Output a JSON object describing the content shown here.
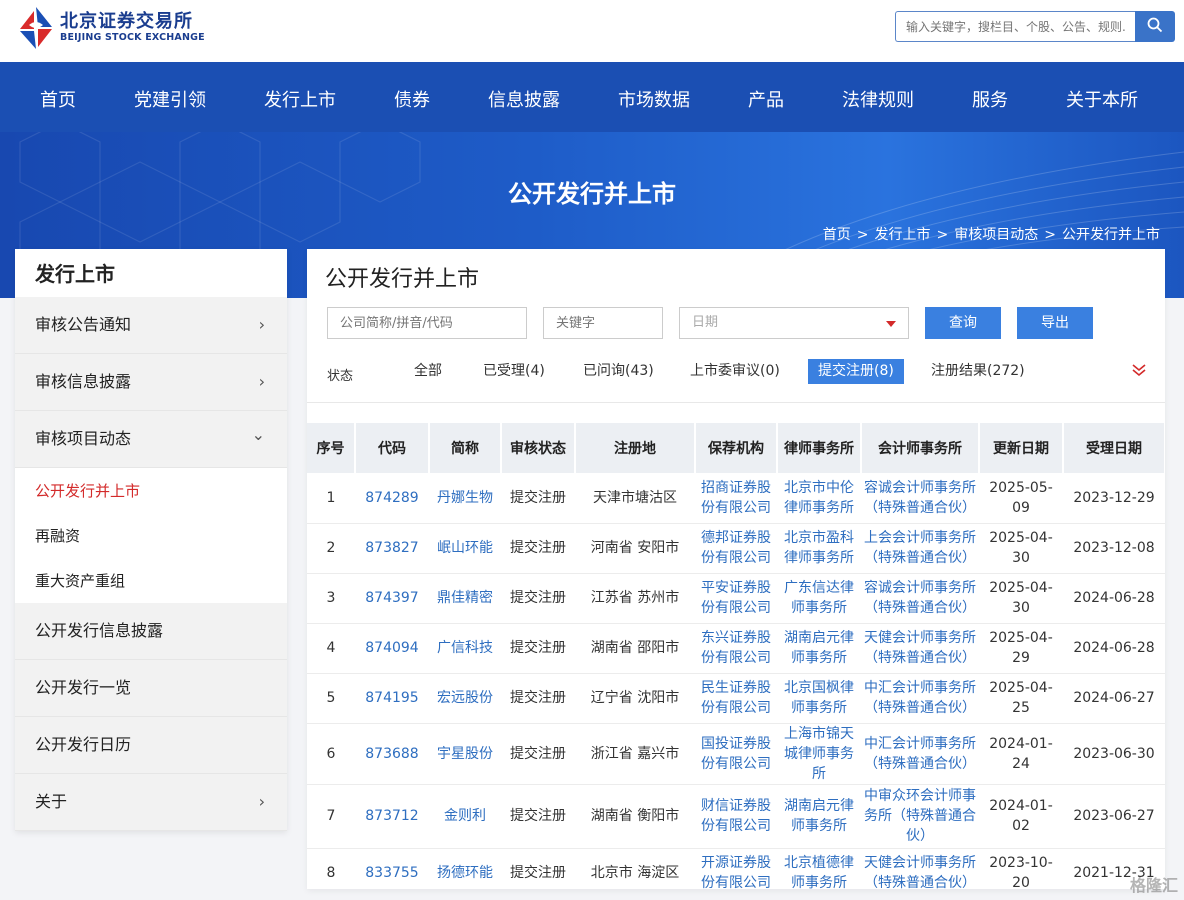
{
  "header": {
    "logo_cn": "北京证券交易所",
    "logo_en": "BEIJING STOCK EXCHANGE",
    "search_placeholder": "输入关键字，搜栏目、个股、公告、规则...",
    "search_icon": "search-icon"
  },
  "nav": [
    "首页",
    "党建引领",
    "发行上市",
    "债券",
    "信息披露",
    "市场数据",
    "产品",
    "法律规则",
    "服务",
    "关于本所"
  ],
  "banner": {
    "title": "公开发行并上市",
    "breadcrumb": [
      "首页",
      "发行上市",
      "审核项目动态",
      "公开发行并上市"
    ],
    "separator": ">"
  },
  "sidebar": {
    "title": "发行上市",
    "items": [
      {
        "label": "审核公告通知",
        "chevron": "›"
      },
      {
        "label": "审核信息披露",
        "chevron": "›"
      },
      {
        "label": "审核项目动态",
        "chevron": "⌄"
      }
    ],
    "subitems": [
      "公开发行并上市",
      "再融资",
      "重大资产重组"
    ],
    "items2": [
      {
        "label": "公开发行信息披露",
        "chevron": ""
      },
      {
        "label": "公开发行一览",
        "chevron": ""
      },
      {
        "label": "公开发行日历",
        "chevron": ""
      },
      {
        "label": "关于",
        "chevron": "›"
      }
    ]
  },
  "main": {
    "title": "公开发行并上市",
    "filters": {
      "company_placeholder": "公司简称/拼音/代码",
      "keyword_placeholder": "关键字",
      "date_placeholder": "日期",
      "query_label": "查询",
      "export_label": "导出"
    },
    "status_label": "状态",
    "status_tabs": [
      "全部",
      "已受理(4)",
      "已问询(43)",
      "上市委审议(0)",
      "提交注册(8)",
      "注册结果(272)"
    ],
    "active_status": "提交注册(8)",
    "accent_color": "#3a80e0",
    "active_color": "#d32a2a"
  },
  "table": {
    "columns": [
      "序号",
      "代码",
      "简称",
      "审核状态",
      "注册地",
      "保荐机构",
      "律师事务所",
      "会计师事务所",
      "更新日期",
      "受理日期"
    ],
    "rows": [
      {
        "no": "1",
        "code": "874289",
        "name": "丹娜生物",
        "status": "提交注册",
        "place": "天津市塘沽区",
        "sponsor": "招商证券股份有限公司",
        "law": "北京市中伦律师事务所",
        "cpa": "容诚会计师事务所（特殊普通合伙）",
        "updated": "2025-05-09",
        "accepted": "2023-12-29"
      },
      {
        "no": "2",
        "code": "873827",
        "name": "岷山环能",
        "status": "提交注册",
        "place": "河南省 安阳市",
        "sponsor": "德邦证券股份有限公司",
        "law": "北京市盈科律师事务所",
        "cpa": "上会会计师事务所（特殊普通合伙）",
        "updated": "2025-04-30",
        "accepted": "2023-12-08"
      },
      {
        "no": "3",
        "code": "874397",
        "name": "鼎佳精密",
        "status": "提交注册",
        "place": "江苏省 苏州市",
        "sponsor": "平安证券股份有限公司",
        "law": "广东信达律师事务所",
        "cpa": "容诚会计师事务所（特殊普通合伙）",
        "updated": "2025-04-30",
        "accepted": "2024-06-28"
      },
      {
        "no": "4",
        "code": "874094",
        "name": "广信科技",
        "status": "提交注册",
        "place": "湖南省 邵阳市",
        "sponsor": "东兴证券股份有限公司",
        "law": "湖南启元律师事务所",
        "cpa": "天健会计师事务所（特殊普通合伙）",
        "updated": "2025-04-29",
        "accepted": "2024-06-28"
      },
      {
        "no": "5",
        "code": "874195",
        "name": "宏远股份",
        "status": "提交注册",
        "place": "辽宁省 沈阳市",
        "sponsor": "民生证券股份有限公司",
        "law": "北京国枫律师事务所",
        "cpa": "中汇会计师事务所（特殊普通合伙）",
        "updated": "2025-04-25",
        "accepted": "2024-06-27"
      },
      {
        "no": "6",
        "code": "873688",
        "name": "宇星股份",
        "status": "提交注册",
        "place": "浙江省 嘉兴市",
        "sponsor": "国投证券股份有限公司",
        "law": "上海市锦天城律师事务所",
        "cpa": "中汇会计师事务所（特殊普通合伙）",
        "updated": "2024-01-24",
        "accepted": "2023-06-30"
      },
      {
        "no": "7",
        "code": "873712",
        "name": "金则利",
        "status": "提交注册",
        "place": "湖南省 衡阳市",
        "sponsor": "财信证券股份有限公司",
        "law": "湖南启元律师事务所",
        "cpa": "中审众环会计师事务所（特殊普通合伙）",
        "updated": "2024-01-02",
        "accepted": "2023-06-27"
      },
      {
        "no": "8",
        "code": "833755",
        "name": "扬德环能",
        "status": "提交注册",
        "place": "北京市 海淀区",
        "sponsor": "开源证券股份有限公司",
        "law": "北京植德律师事务所",
        "cpa": "天健会计师事务所（特殊普通合伙）",
        "updated": "2023-10-20",
        "accepted": "2021-12-31"
      }
    ]
  },
  "watermark": "格隆汇"
}
